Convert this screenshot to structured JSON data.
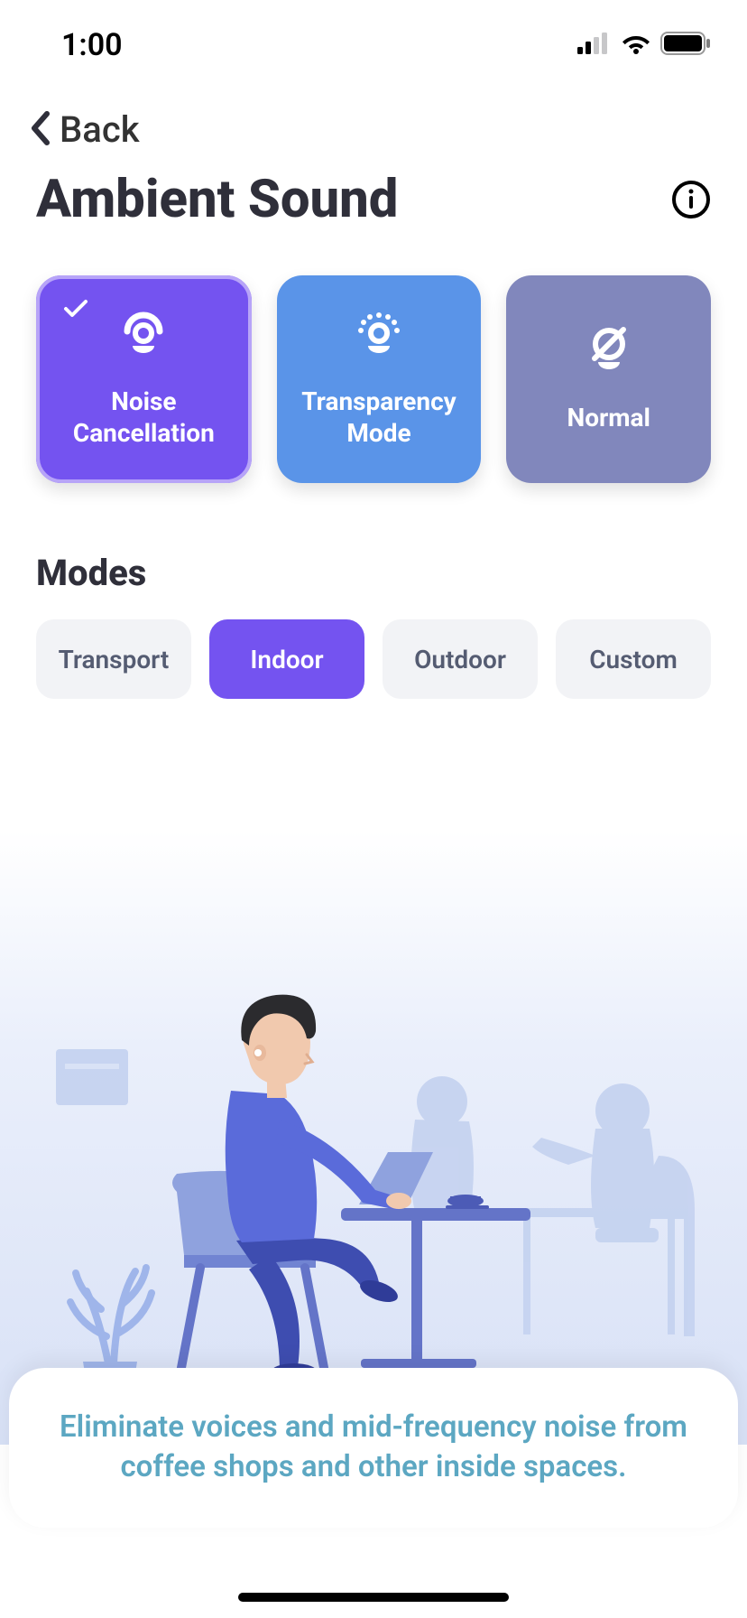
{
  "status": {
    "time": "1:00"
  },
  "nav": {
    "back_label": "Back"
  },
  "header": {
    "title": "Ambient Sound"
  },
  "sound_modes": [
    {
      "label": "Noise\nCancellation",
      "selected": true
    },
    {
      "label": "Transparency\nMode",
      "selected": false
    },
    {
      "label": "Normal",
      "selected": false
    }
  ],
  "section": {
    "modes_title": "Modes"
  },
  "modes": [
    {
      "label": "Transport",
      "active": false
    },
    {
      "label": "Indoor",
      "active": true
    },
    {
      "label": "Outdoor",
      "active": false
    },
    {
      "label": "Custom",
      "active": false
    }
  ],
  "description": "Eliminate voices and mid-frequency noise from coffee shops and other inside spaces."
}
